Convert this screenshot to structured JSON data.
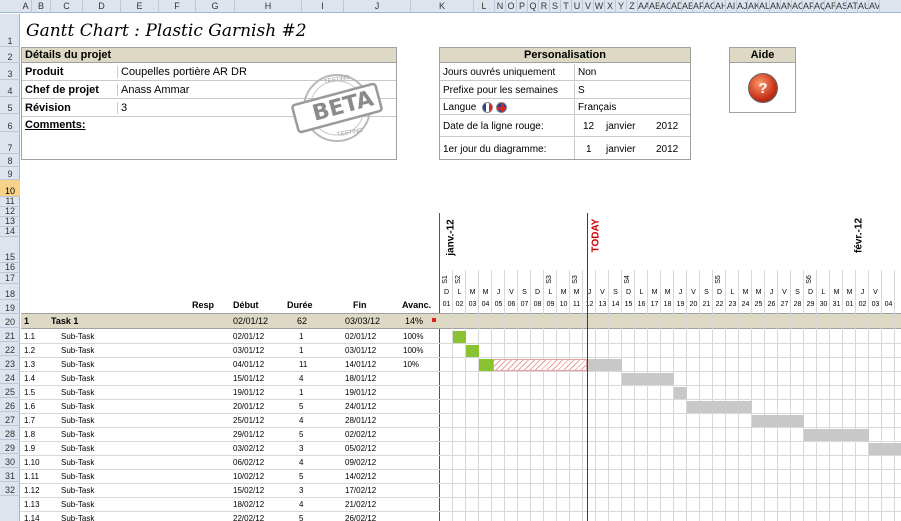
{
  "columns": [
    "A",
    "B",
    "C",
    "D",
    "E",
    "F",
    "G",
    "H",
    "I",
    "J",
    "K",
    "L",
    "N",
    "O",
    "P",
    "Q",
    "R",
    "S",
    "T",
    "U",
    "V",
    "W",
    "X",
    "Y",
    "Z",
    "AA",
    "AB",
    "AC",
    "AD",
    "AE",
    "AF",
    "AG",
    "AH",
    "AI",
    "AJ",
    "AK",
    "AL",
    "AM",
    "AN",
    "AO",
    "AP",
    "AQ",
    "AR",
    "AS",
    "AT",
    "AU",
    "AV"
  ],
  "rows": [
    "1",
    "2",
    "3",
    "4",
    "5",
    "6",
    "7",
    "8",
    "9",
    "10",
    "11",
    "12",
    "13",
    "14",
    "15",
    "16",
    "17",
    "18",
    "19",
    "20",
    "21",
    "22",
    "23",
    "24",
    "25",
    "26",
    "27",
    "28",
    "29",
    "30",
    "31",
    "32"
  ],
  "selected_row": "10",
  "title": "Gantt Chart : Plastic Garnish #2",
  "project": {
    "header": "Détails du projet",
    "produit_label": "Produit",
    "produit_value": "Coupelles portière AR DR",
    "chef_label": "Chef de projet",
    "chef_value": "Anass Ammar",
    "revision_label": "Révision",
    "revision_value": "3",
    "comments_label": "Comments:"
  },
  "stamp": {
    "text": "BETA",
    "small": "TESTING"
  },
  "personalisation": {
    "header": "Personalisation",
    "jours_label": "Jours ouvrés uniquement",
    "jours_value": "Non",
    "prefixe_label": "Prefixe pour les semaines",
    "prefixe_value": "S",
    "langue_label": "Langue",
    "langue_value": "Français",
    "date_rouge_label": "Date de la ligne rouge:",
    "date_rouge_day": "12",
    "date_rouge_month": "janvier",
    "date_rouge_year": "2012",
    "premier_jour_label": "1er jour du diagramme:",
    "premier_jour_day": "1",
    "premier_jour_month": "janvier",
    "premier_jour_year": "2012"
  },
  "aide": {
    "header": "Aide"
  },
  "gantt": {
    "month1": "janv.-12",
    "month2": "févr.-12",
    "today": "TODAY",
    "weeks": [
      "S1",
      "S2",
      "S3",
      "S3",
      "S4",
      "S5",
      "S6"
    ],
    "day_letters": [
      "D",
      "L",
      "M",
      "M",
      "J",
      "V",
      "S",
      "D",
      "L",
      "M",
      "M",
      "J",
      "V",
      "S",
      "D",
      "L",
      "M",
      "M",
      "J",
      "V",
      "S",
      "D",
      "L",
      "M",
      "M",
      "J",
      "V",
      "S",
      "D",
      "L",
      "M",
      "M",
      "J",
      "V"
    ],
    "day_numbers": [
      "01",
      "02",
      "03",
      "04",
      "05",
      "06",
      "07",
      "08",
      "09",
      "10",
      "11",
      "12",
      "13",
      "14",
      "15",
      "16",
      "17",
      "18",
      "19",
      "20",
      "21",
      "22",
      "23",
      "24",
      "25",
      "26",
      "27",
      "28",
      "29",
      "30",
      "31",
      "01",
      "02",
      "03",
      "04"
    ]
  },
  "table": {
    "headers": {
      "resp": "Resp",
      "debut": "Début",
      "duree": "Durée",
      "fin": "Fin",
      "avanc": "Avanc."
    },
    "task": {
      "num": "1",
      "name": "Task 1",
      "debut": "02/01/12",
      "duree": "62",
      "fin": "03/03/12",
      "avanc": "14%"
    },
    "subtasks": [
      {
        "num": "1.1",
        "name": "Sub-Task",
        "debut": "02/01/12",
        "duree": "1",
        "fin": "02/01/12",
        "avanc": "100%"
      },
      {
        "num": "1.2",
        "name": "Sub-Task",
        "debut": "03/01/12",
        "duree": "1",
        "fin": "03/01/12",
        "avanc": "100%"
      },
      {
        "num": "1.3",
        "name": "Sub-Task",
        "debut": "04/01/12",
        "duree": "11",
        "fin": "14/01/12",
        "avanc": "10%"
      },
      {
        "num": "1.4",
        "name": "Sub-Task",
        "debut": "15/01/12",
        "duree": "4",
        "fin": "18/01/12",
        "avanc": ""
      },
      {
        "num": "1.5",
        "name": "Sub-Task",
        "debut": "19/01/12",
        "duree": "1",
        "fin": "19/01/12",
        "avanc": ""
      },
      {
        "num": "1.6",
        "name": "Sub-Task",
        "debut": "20/01/12",
        "duree": "5",
        "fin": "24/01/12",
        "avanc": ""
      },
      {
        "num": "1.7",
        "name": "Sub-Task",
        "debut": "25/01/12",
        "duree": "4",
        "fin": "28/01/12",
        "avanc": ""
      },
      {
        "num": "1.8",
        "name": "Sub-Task",
        "debut": "29/01/12",
        "duree": "5",
        "fin": "02/02/12",
        "avanc": ""
      },
      {
        "num": "1.9",
        "name": "Sub-Task",
        "debut": "03/02/12",
        "duree": "3",
        "fin": "05/02/12",
        "avanc": ""
      },
      {
        "num": "1.10",
        "name": "Sub-Task",
        "debut": "06/02/12",
        "duree": "4",
        "fin": "09/02/12",
        "avanc": ""
      },
      {
        "num": "1.11",
        "name": "Sub-Task",
        "debut": "10/02/12",
        "duree": "5",
        "fin": "14/02/12",
        "avanc": ""
      },
      {
        "num": "1.12",
        "name": "Sub-Task",
        "debut": "15/02/12",
        "duree": "3",
        "fin": "17/02/12",
        "avanc": ""
      },
      {
        "num": "1.13",
        "name": "Sub-Task",
        "debut": "18/02/12",
        "duree": "4",
        "fin": "21/02/12",
        "avanc": ""
      },
      {
        "num": "1.14",
        "name": "Sub-Task",
        "debut": "22/02/12",
        "duree": "5",
        "fin": "26/02/12",
        "avanc": ""
      }
    ]
  },
  "colors": {
    "green": "#8bc232",
    "grey": "#c8c8c8",
    "today_line": "#cc0000",
    "header_bg": "#ddd9c4",
    "task_row": "#ddd9c4"
  }
}
